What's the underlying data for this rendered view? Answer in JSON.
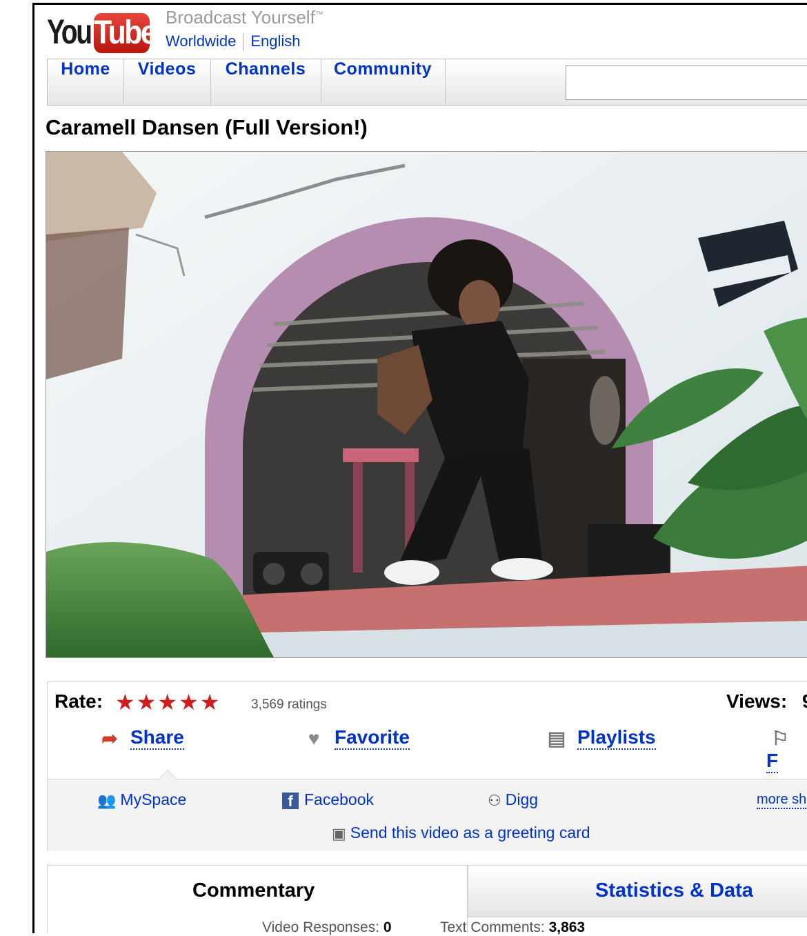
{
  "header": {
    "logo_you": "You",
    "logo_tube": "Tube",
    "tagline": "Broadcast Yourself",
    "tagline_mark": "™",
    "region": "Worldwide",
    "language": "English"
  },
  "nav": {
    "tabs": [
      "Home",
      "Videos",
      "Channels",
      "Community"
    ],
    "search_value": ""
  },
  "video": {
    "title": "Caramell Dansen (Full Version!)"
  },
  "rating": {
    "label": "Rate:",
    "stars": "★★★★★",
    "count": "3,569 ratings",
    "views_label": "Views:",
    "views_value": "9"
  },
  "actions": {
    "share": "Share",
    "favorite": "Favorite",
    "playlists": "Playlists",
    "flag": "F"
  },
  "share_options": {
    "myspace": "MySpace",
    "facebook": "Facebook",
    "facebook_glyph": "f",
    "digg": "Digg",
    "more": "more sh",
    "greeting": "Send this video as a greeting card"
  },
  "tabs": {
    "commentary": "Commentary",
    "statistics": "Statistics & Data"
  },
  "counts": {
    "video_responses_label": "Video Responses:",
    "video_responses_value": "0",
    "text_comments_label": "Text Comments:",
    "text_comments_value": "3,863"
  },
  "colors": {
    "link": "#0033cc",
    "star": "#d01c1c",
    "logo_red": "#cc2518"
  }
}
